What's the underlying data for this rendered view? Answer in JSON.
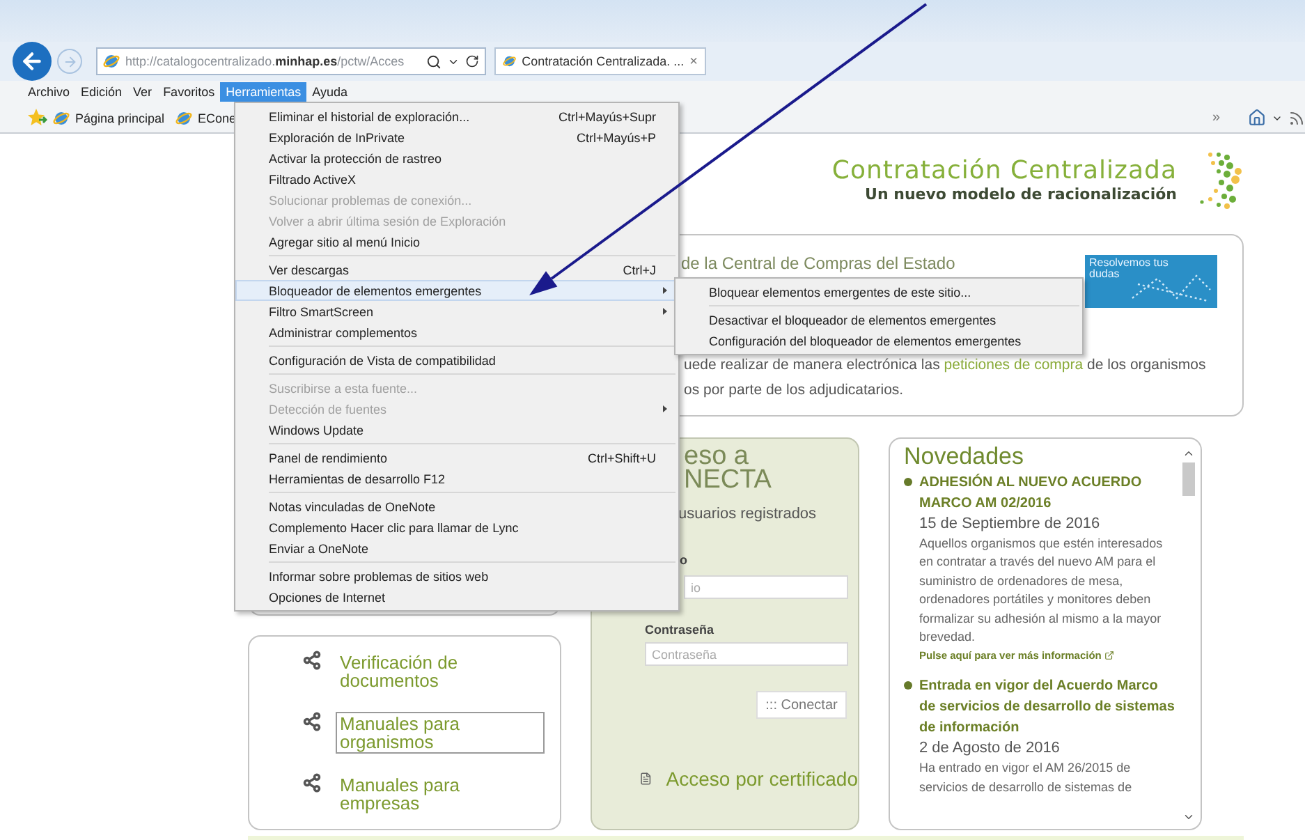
{
  "browser": {
    "address": "http://catalogocentralizado.**minhap.es**/pctw/Acces",
    "tab": {
      "title": "Contratación Centralizada. ...",
      "close": "×"
    }
  },
  "menu_bar": [
    {
      "label": "Archivo",
      "selected": false
    },
    {
      "label": "Edición",
      "selected": false
    },
    {
      "label": "Ver",
      "selected": false
    },
    {
      "label": "Favoritos",
      "selected": false
    },
    {
      "label": "Herramientas",
      "selected": true
    },
    {
      "label": "Ayuda",
      "selected": false
    }
  ],
  "favorites_bar": {
    "items": [
      "Página principal",
      "ECone"
    ],
    "overflow": "»"
  },
  "tools_menu": {
    "groups": [
      [
        {
          "label": "Eliminar el historial de exploración...",
          "shortcut": "Ctrl+Mayús+Supr",
          "submenu": false,
          "disabled": false,
          "selected": false
        },
        {
          "label": "Exploración de InPrivate",
          "shortcut": "Ctrl+Mayús+P",
          "submenu": false,
          "disabled": false,
          "selected": false
        },
        {
          "label": "Activar la protección de rastreo",
          "submenu": false,
          "disabled": false,
          "selected": false
        },
        {
          "label": "Filtrado ActiveX",
          "submenu": false,
          "disabled": false,
          "selected": false
        },
        {
          "label": "Solucionar problemas de conexión...",
          "submenu": false,
          "disabled": true,
          "selected": false
        },
        {
          "label": "Volver a abrir última sesión de Exploración",
          "submenu": false,
          "disabled": true,
          "selected": false
        },
        {
          "label": "Agregar sitio al menú Inicio",
          "submenu": false,
          "disabled": false,
          "selected": false
        }
      ],
      [
        {
          "label": "Ver descargas",
          "shortcut": "Ctrl+J",
          "submenu": false,
          "disabled": false,
          "selected": false
        },
        {
          "label": "Bloqueador de elementos emergentes",
          "submenu": true,
          "disabled": false,
          "selected": true
        },
        {
          "label": "Filtro SmartScreen",
          "submenu": true,
          "disabled": false,
          "selected": false
        },
        {
          "label": "Administrar complementos",
          "submenu": false,
          "disabled": false,
          "selected": false
        }
      ],
      [
        {
          "label": "Configuración de Vista de compatibilidad",
          "submenu": false,
          "disabled": false,
          "selected": false
        }
      ],
      [
        {
          "label": "Suscribirse a esta fuente...",
          "submenu": false,
          "disabled": true,
          "selected": false
        },
        {
          "label": "Detección de fuentes",
          "submenu": true,
          "disabled": true,
          "selected": false
        },
        {
          "label": "Windows Update",
          "submenu": false,
          "disabled": false,
          "selected": false
        }
      ],
      [
        {
          "label": "Panel de rendimiento",
          "shortcut": "Ctrl+Shift+U",
          "submenu": false,
          "disabled": false,
          "selected": false
        },
        {
          "label": "Herramientas de desarrollo F12",
          "submenu": false,
          "disabled": false,
          "selected": false
        }
      ],
      [
        {
          "label": "Notas vinculadas de OneNote",
          "submenu": false,
          "disabled": false,
          "selected": false
        },
        {
          "label": "Complemento Hacer clic para llamar de Lync",
          "submenu": false,
          "disabled": false,
          "selected": false
        },
        {
          "label": "Enviar a OneNote",
          "submenu": false,
          "disabled": false,
          "selected": false
        }
      ],
      [
        {
          "label": "Informar sobre problemas de sitios web",
          "submenu": false,
          "disabled": false,
          "selected": false
        },
        {
          "label": "Opciones de Internet",
          "submenu": false,
          "disabled": false,
          "selected": false
        }
      ]
    ]
  },
  "popup_submenu": {
    "groups": [
      [
        {
          "label": "Bloquear elementos emergentes de este sitio...",
          "submenu": false,
          "disabled": false,
          "selected": false
        }
      ],
      [
        {
          "label": "Desactivar el bloqueador de elementos emergentes",
          "submenu": false,
          "disabled": false,
          "selected": false
        },
        {
          "label": "Configuración del bloqueador de elementos emergentes",
          "submenu": false,
          "disabled": false,
          "selected": false
        }
      ]
    ]
  },
  "logo": {
    "title": "Contratación Centralizada",
    "subtitle": "Un nuevo modelo de racionalización"
  },
  "intro": {
    "heading": "de la Central de Compras del Estado",
    "banner": "Resolvemos tus dudas",
    "line_1": {
      "before": "uede realizar de manera electrónica las ",
      "link": "peticiones de compra",
      "after": " de los organismos"
    },
    "line_2": "os por parte de los adjudicatarios."
  },
  "links": [
    {
      "label": "Verificación de documentos",
      "focused": false
    },
    {
      "label": "Manuales para organismos",
      "focused": true
    },
    {
      "label": "Manuales para empresas",
      "focused": false
    }
  ],
  "login": {
    "title": [
      "eso a",
      "NECTA"
    ],
    "subtitle": "usuarios registrados",
    "user_label": "o",
    "user_placeholder": "io",
    "password_label": "Contraseña",
    "password_placeholder": "Contraseña",
    "button": "::: Conectar",
    "certificate": "Acceso por certificado"
  },
  "news": {
    "title": "Novedades",
    "items": [
      {
        "title": "ADHESIÓN AL NUEVO ACUERDO MARCO AM 02/2016",
        "date": "15 de Septiembre de 2016",
        "body": "Aquellos organismos que estén interesados en contratar a través del nuevo AM para el suministro de ordenadores de mesa, ordenadores portátiles y monitores deben formalizar su adhesión al mismo a la mayor brevedad.",
        "more": "Pulse aquí para ver más información"
      },
      {
        "title": "Entrada en vigor del Acuerdo Marco de servicios de desarrollo de sistemas de información",
        "date": "2 de Agosto de 2016",
        "body": "Ha entrado en vigor el AM 26/2015 de servicios de desarrollo de sistemas de"
      }
    ]
  }
}
